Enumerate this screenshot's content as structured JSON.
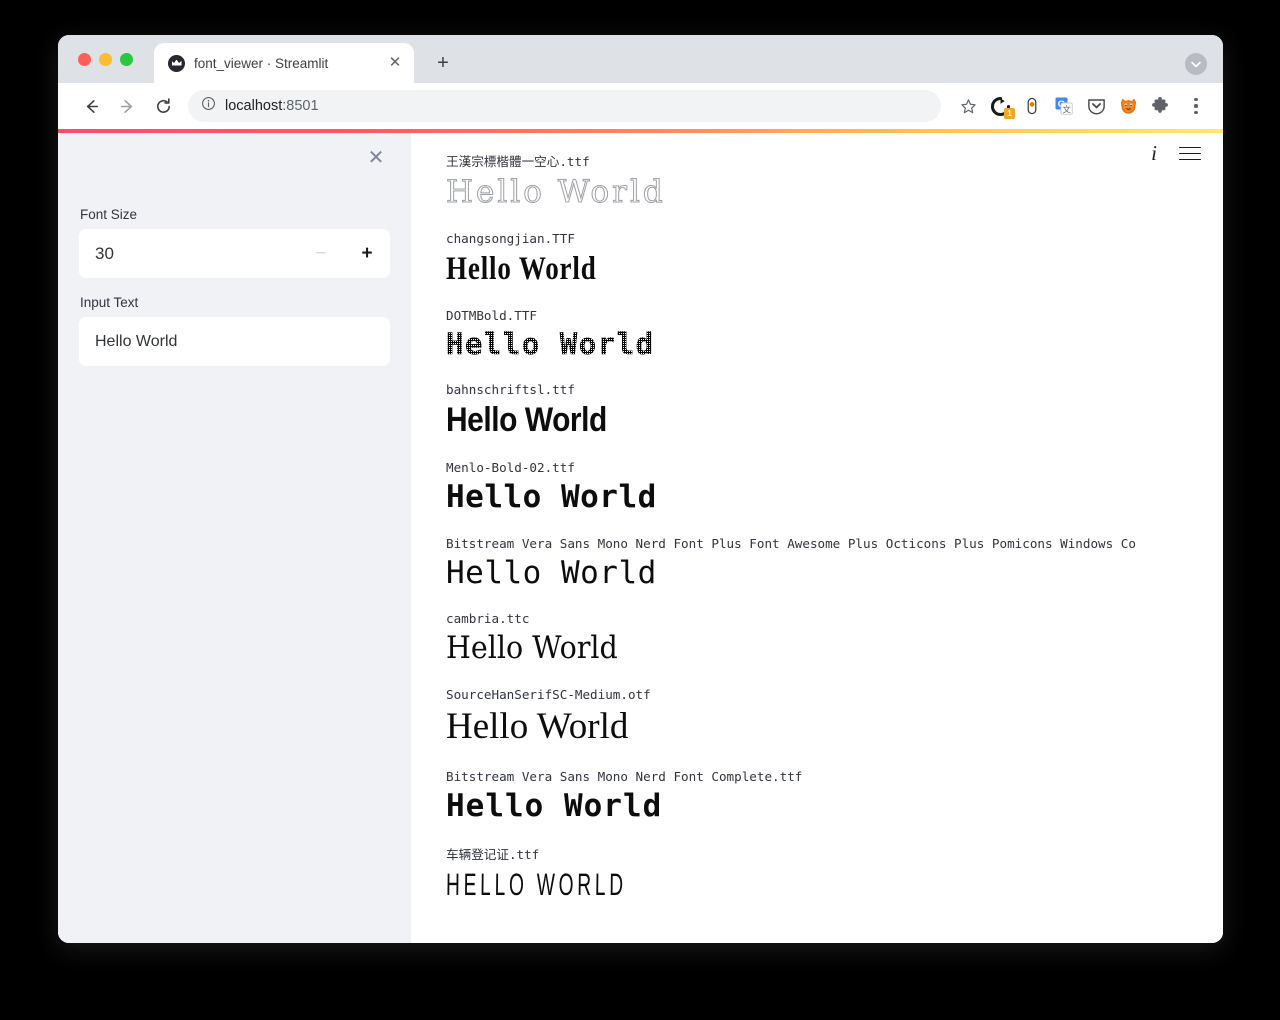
{
  "browser": {
    "tab": {
      "title": "font_viewer · Streamlit",
      "favicon": "streamlit-favicon",
      "close_label": "✕"
    },
    "new_tab_label": "+",
    "url": {
      "host": "localhost",
      "port": ":8501",
      "info_icon": "info-circle-icon"
    },
    "nav": {
      "back": "←",
      "forward": "→",
      "reload": "⟳"
    },
    "toolbar_icons": [
      {
        "name": "bookmark-star-icon"
      },
      {
        "name": "dark-circle-extension-icon",
        "badge": "1"
      },
      {
        "name": "capsule-extension-icon"
      },
      {
        "name": "google-translate-icon"
      },
      {
        "name": "pocket-shield-icon"
      },
      {
        "name": "firefox-fox-icon"
      },
      {
        "name": "puzzle-extensions-icon"
      },
      {
        "name": "chrome-menu-icon"
      }
    ]
  },
  "theme": {
    "accent_start": "#ff4b6e",
    "accent_end": "#ffe86a",
    "sidebar_bg": "#f0f2f6",
    "text": "#31333f"
  },
  "sidebar": {
    "close_label": "✕",
    "font_size": {
      "label": "Font Size",
      "value": "30",
      "minus_label": "−",
      "plus_label": "+"
    },
    "input_text": {
      "label": "Input Text",
      "value": "Hello World",
      "placeholder": "Hello World"
    }
  },
  "main": {
    "tools": {
      "info_label": "i",
      "menu_label": "☰"
    },
    "fonts": [
      {
        "name": "王漢宗標楷體一空心.ttf",
        "sample": "Hello World",
        "style": "s-outline"
      },
      {
        "name": "changsongjian.TTF",
        "sample": "Hello World",
        "style": "s-songcond"
      },
      {
        "name": "DOTMBold.TTF",
        "sample": "Hello World",
        "style": "s-dot"
      },
      {
        "name": "bahnschriftsl.ttf",
        "sample": "Hello World",
        "style": "s-bahn"
      },
      {
        "name": "Menlo-Bold-02.ttf",
        "sample": "Hello World",
        "style": "s-menlo"
      },
      {
        "name": "Bitstream Vera Sans Mono Nerd Font Plus Font Awesome Plus Octicons Plus Pomicons Windows Co",
        "sample": "Hello World",
        "style": "s-vera"
      },
      {
        "name": "cambria.ttc",
        "sample": "Hello World",
        "style": "s-cambria"
      },
      {
        "name": "SourceHanSerifSC-Medium.otf",
        "sample": "Hello World",
        "style": "s-hanserif"
      },
      {
        "name": "Bitstream Vera Sans Mono Nerd Font Complete.ttf",
        "sample": "Hello World",
        "style": "s-veracomplete"
      },
      {
        "name": "车辆登记证.ttf",
        "sample": "HELLO WORLD",
        "style": "s-chinese"
      }
    ]
  }
}
